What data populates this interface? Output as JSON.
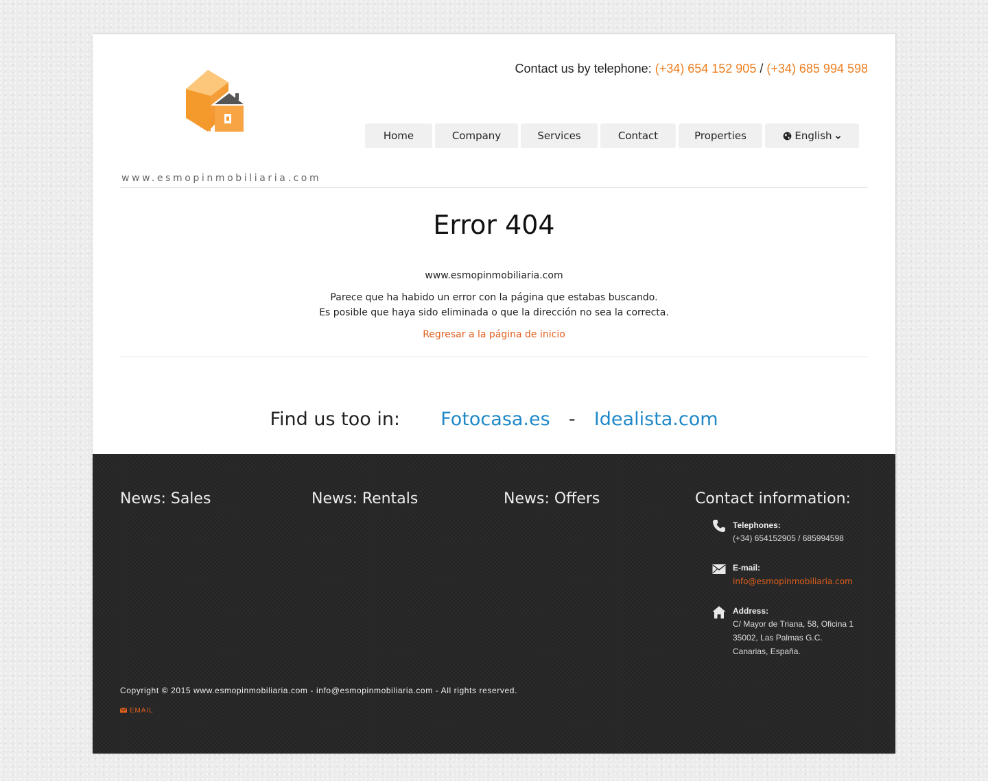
{
  "header": {
    "logo_text": "www.esmopinmobiliaria.com",
    "contact_prefix": "Contact us by telephone:",
    "phone1": "(+34) 654 152 905",
    "separator": "/",
    "phone2": "(+34) 685 994 598"
  },
  "nav": {
    "items": [
      {
        "label": "Home"
      },
      {
        "label": "Company"
      },
      {
        "label": "Services"
      },
      {
        "label": "Contact"
      },
      {
        "label": "Properties"
      }
    ],
    "language": "English"
  },
  "error": {
    "title": "Error 404",
    "site": "www.esmopinmobiliaria.com",
    "message1": "Parece que ha habido un error con la página que estabas buscando.",
    "message2": "Es posible que haya sido eliminada o que la dirección no sea la correcta.",
    "back_link": "Regresar a la página de inicio"
  },
  "find_us": {
    "label": "Find us too in:",
    "link1": "Fotocasa.es",
    "dash": "-",
    "link2": "Idealista.com"
  },
  "footer": {
    "columns": [
      "News: Sales",
      "News: Rentals",
      "News: Offers",
      "Contact information:"
    ],
    "telephones_label": "Telephones:",
    "telephones_value": "(+34) 654152905 / 685994598",
    "email_label": "E-mail:",
    "email_value": "info@esmopinmobiliaria.com",
    "address_label": "Address:",
    "address_lines": [
      "C/ Mayor de Triana, 58, Oficina 1",
      "35002, Las Palmas G.C.",
      "Canarias, España."
    ],
    "copyright": "Copyright © 2015 www.esmopinmobiliaria.com - info@esmopinmobiliaria.com - All rights reserved.",
    "email_button": "EMAIL"
  },
  "colors": {
    "accent_orange": "#ee7f22",
    "link_orange": "#e0601d",
    "link_blue": "#1e88c8",
    "footer_bg": "#252525"
  },
  "icons": [
    "globe-icon",
    "chevron-down-icon",
    "phone-icon",
    "envelope-icon",
    "home-icon",
    "house-logo-icon"
  ]
}
